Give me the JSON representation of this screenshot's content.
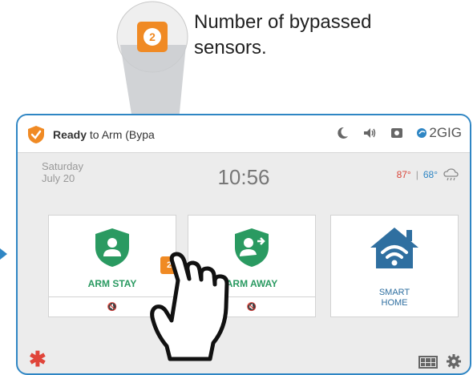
{
  "callout": {
    "line1": "Number of bypassed",
    "line2": "sensors.",
    "badge_number": "2"
  },
  "topbar": {
    "status_bold": "Ready",
    "status_rest": " to Arm (Bypa",
    "brand": "2GIG",
    "icons": [
      "moon-icon",
      "speaker-icon",
      "camera-icon",
      "brand-logo-icon"
    ]
  },
  "datetime": {
    "day": "Saturday",
    "date": "July 20",
    "time": "10:56"
  },
  "weather": {
    "high": "87°",
    "separator": "|",
    "low": "68°",
    "icon": "rain-cloud-icon"
  },
  "tiles": {
    "arm_stay": {
      "label": "ARM STAY"
    },
    "arm_away": {
      "label": "ARM AWAY"
    },
    "smart_home": {
      "line1": "SMART",
      "line2": "HOME"
    }
  },
  "bypass_badge": "2",
  "colors": {
    "frame": "#2f86c4",
    "green": "#2a9a61",
    "orange": "#f08a24",
    "red": "#e0453a",
    "blue": "#2f86c4"
  }
}
